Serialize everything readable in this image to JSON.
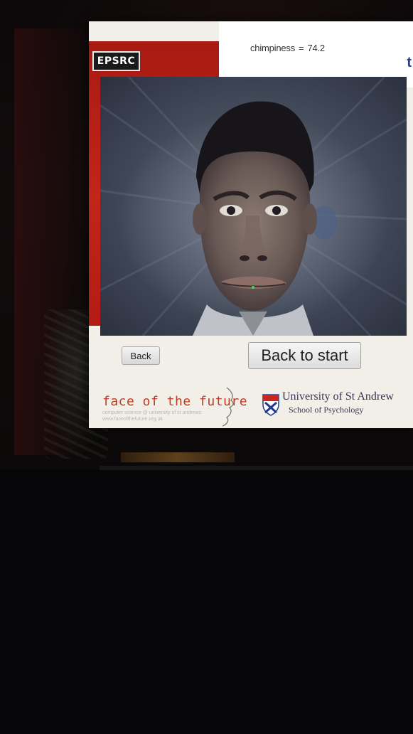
{
  "header": {
    "epsrc_logo": "EPSRC",
    "score_label": "chimpiness",
    "score_value": "74.2",
    "cut_link_text": "t"
  },
  "face_image": {
    "alt": "Morphed face image"
  },
  "controls": {
    "back_label": "Back",
    "back_to_start_label": "Back to start"
  },
  "footer": {
    "project_title": "face of the future",
    "project_line1": "computer science @ university of st andrews",
    "project_line2": "www.faceofthefuture.org.uk",
    "university_name": "University of St Andrew",
    "school_name": "School of Psychology"
  },
  "colors": {
    "red_band": "#c2251a",
    "link_blue": "#2a3d8a",
    "title_red": "#c23a22",
    "university_text": "#3a3556"
  },
  "icons": {
    "crest": "university-crest-icon",
    "profile": "face-profile-line-icon"
  }
}
